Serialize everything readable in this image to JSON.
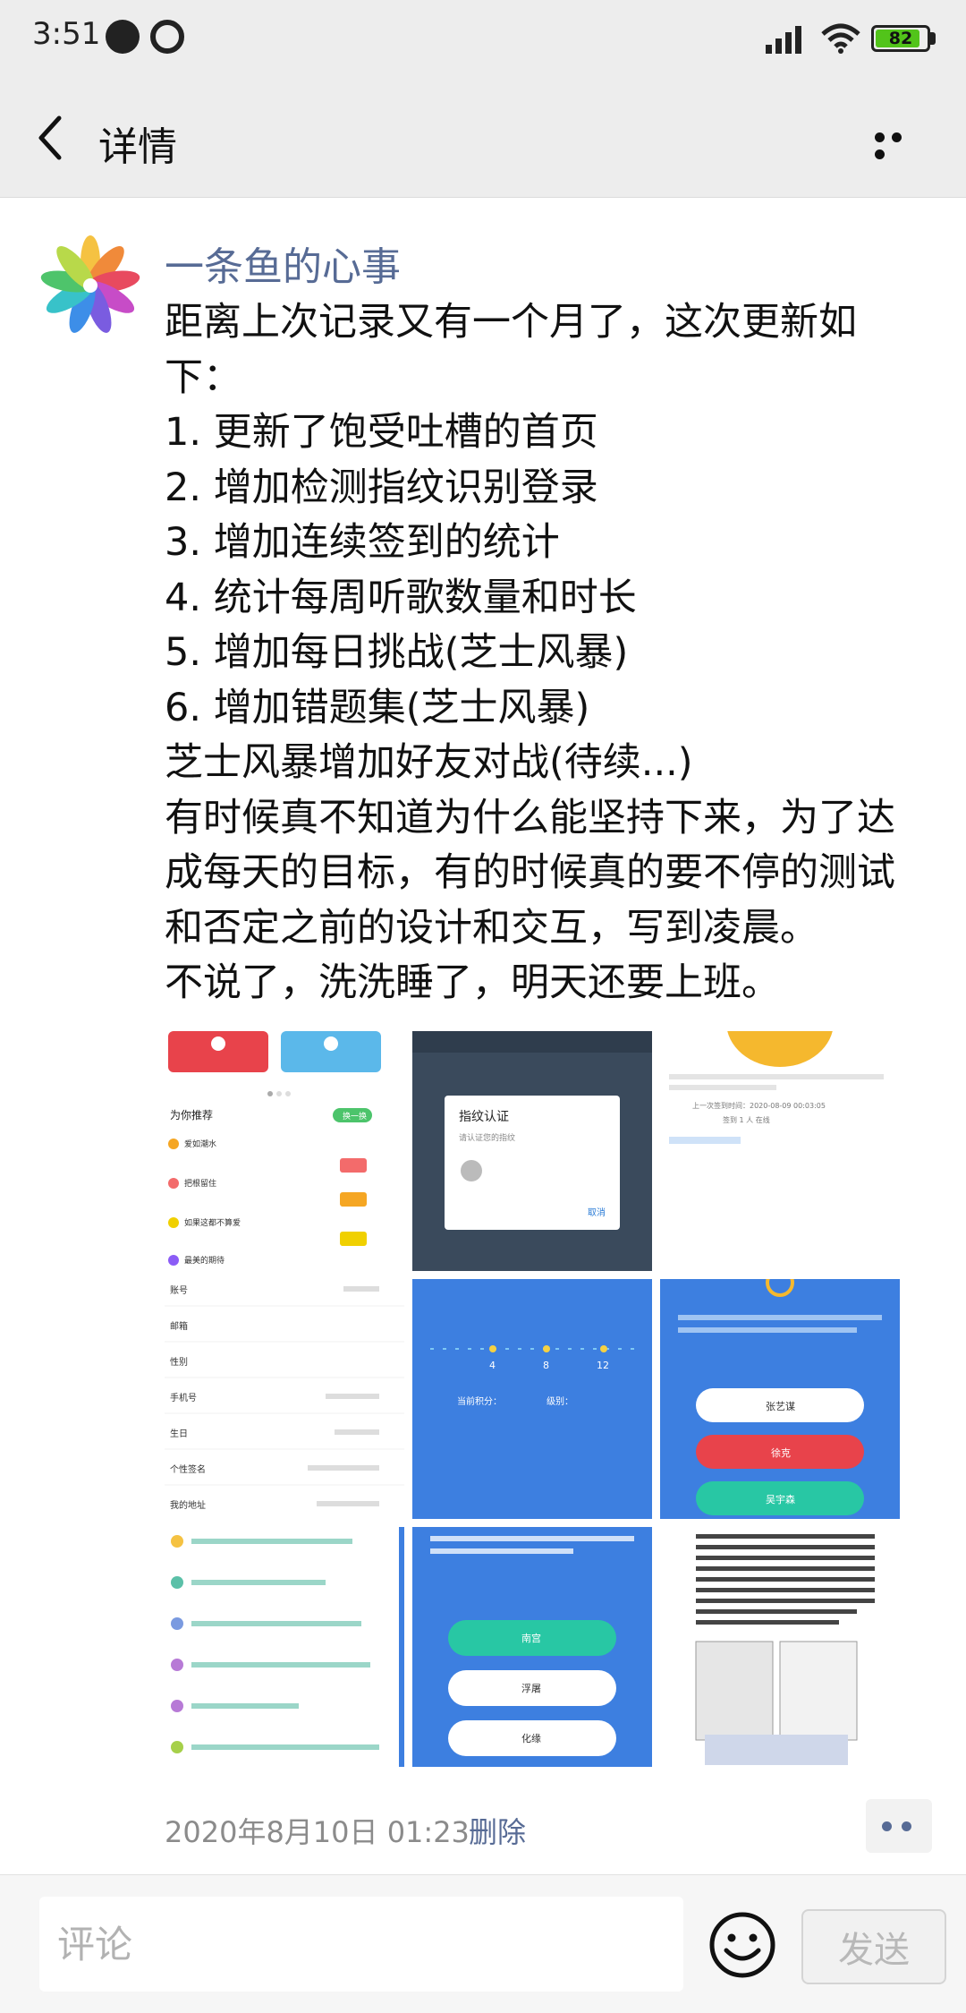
{
  "status_bar": {
    "time": "3:51",
    "battery": "82",
    "battery_level": 0.82,
    "icons": [
      "paper-plane-icon",
      "sync-icon",
      "signal-icon",
      "wifi-icon",
      "battery-icon"
    ]
  },
  "nav": {
    "title": "详情",
    "back_icon": "chevron-left-icon",
    "more_icon": "more-dots-icon"
  },
  "post": {
    "author": "一条鱼的心事",
    "lines": [
      "距离上次记录又有一个月了，这次更新如",
      "下：",
      "1. 更新了饱受吐槽的首页",
      "2. 增加检测指纹识别登录",
      "3. 增加连续签到的统计",
      "4. 统计每周听歌数量和时长",
      "5. 增加每日挑战(芝士风暴)",
      "6. 增加错题集(芝士风暴)",
      "芝士风暴增加好友对战(待续...)",
      "有时候真不知道为什么能坚持下来，为了达",
      "成每天的目标，有的时候真的要不停的测试",
      "和否定之前的设计和交互，写到凌晨。",
      "不说了，洗洗睡了，明天还要上班。"
    ],
    "timestamp": "2020年8月10日 01:23",
    "delete_label": "删除"
  },
  "images": [
    {
      "name": "app-home-screenshot",
      "texts": [
        "为你推荐",
        "换一换",
        "爱如潮水",
        "把根留住",
        "如果这都不算爱",
        "最美的期待"
      ]
    },
    {
      "name": "fingerprint-dialog-screenshot",
      "texts": [
        "指纹认证",
        "请认证您的指纹",
        "取消"
      ]
    },
    {
      "name": "signin-location-screenshot",
      "texts": [
        "上一次签到时间：2020-08-09 00:03:05",
        "签到 1 人 在线"
      ]
    },
    {
      "name": "profile-settings-screenshot",
      "texts": [
        "账号",
        "邮箱",
        "性别",
        "手机号",
        "生日",
        "个性签名",
        "我的地址"
      ]
    },
    {
      "name": "weekly-stats-screenshot",
      "texts": [
        "4",
        "8",
        "12",
        "当前积分：",
        "级别："
      ]
    },
    {
      "name": "daily-challenge-screenshot",
      "texts": [
        "张艺谋",
        "徐克",
        "吴宇森"
      ]
    },
    {
      "name": "wrong-answers-screenshot",
      "texts": []
    },
    {
      "name": "friend-battle-screenshot",
      "texts": [
        "南宫",
        "浮屠",
        "化缘"
      ]
    },
    {
      "name": "code-article-screenshot",
      "texts": []
    }
  ],
  "input_bar": {
    "placeholder": "评论",
    "send_label": "发送",
    "emoji_icon": "emoji-smile-icon"
  },
  "colors": {
    "link": "#576b95",
    "bar_bg": "#ededed",
    "battery_green": "#52c41a"
  }
}
